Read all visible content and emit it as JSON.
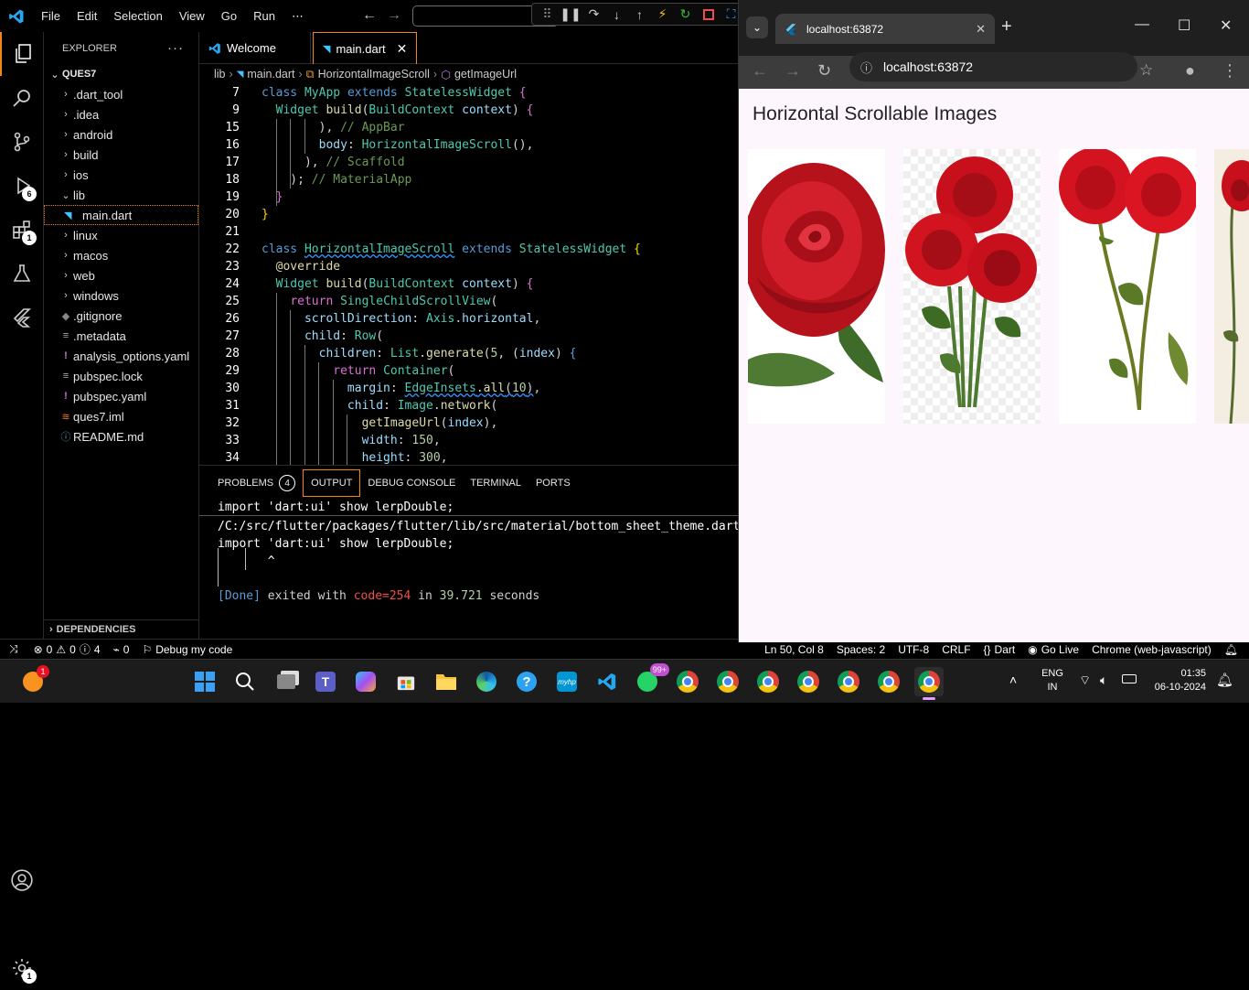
{
  "titlebar": {
    "menus": [
      "File",
      "Edit",
      "Selection",
      "View",
      "Go",
      "Run",
      "⋯"
    ]
  },
  "activity": {
    "run_badge": "6",
    "extensions_badge": "1",
    "settings_badge": "1"
  },
  "explorer": {
    "title": "EXPLORER",
    "folder": "QUES7",
    "items": [
      {
        "label": ".dart_tool",
        "type": "folder"
      },
      {
        "label": ".idea",
        "type": "folder"
      },
      {
        "label": "android",
        "type": "folder"
      },
      {
        "label": "build",
        "type": "folder"
      },
      {
        "label": "ios",
        "type": "folder"
      },
      {
        "label": "lib",
        "type": "folder-open"
      },
      {
        "label": "main.dart",
        "type": "file-dart"
      },
      {
        "label": "linux",
        "type": "folder"
      },
      {
        "label": "macos",
        "type": "folder"
      },
      {
        "label": "web",
        "type": "folder"
      },
      {
        "label": "windows",
        "type": "folder"
      },
      {
        "label": ".gitignore",
        "type": "file"
      },
      {
        "label": ".metadata",
        "type": "file"
      },
      {
        "label": "analysis_options.yaml",
        "type": "file-yaml"
      },
      {
        "label": "pubspec.lock",
        "type": "file"
      },
      {
        "label": "pubspec.yaml",
        "type": "file-yaml"
      },
      {
        "label": "ques7.iml",
        "type": "file"
      },
      {
        "label": "README.md",
        "type": "file-info"
      }
    ],
    "dependencies": "DEPENDENCIES"
  },
  "tabs": [
    {
      "label": "Welcome",
      "active": false
    },
    {
      "label": "main.dart",
      "active": true
    }
  ],
  "breadcrumb": [
    "lib",
    "main.dart",
    "HorizontalImageScroll",
    "getImageUrl"
  ],
  "code_lines": [
    "7",
    "9",
    "15",
    "16",
    "17",
    "18",
    "19",
    "20",
    "21",
    "22",
    "23",
    "24",
    "25",
    "26",
    "27",
    "28",
    "29",
    "30",
    "31",
    "32",
    "33",
    "34"
  ],
  "panel": {
    "tabs": [
      "PROBLEMS",
      "OUTPUT",
      "DEBUG CONSOLE",
      "TERMINAL",
      "PORTS"
    ],
    "problems_count": "4",
    "output_lines": [
      "import 'dart:ui' show lerpDouble;",
      "/C:/src/flutter/packages/flutter/lib/src/material/bottom_sheet_theme.dart:",
      "import 'dart:ui' show lerpDouble;",
      "       ^"
    ],
    "done_line": {
      "prefix": "[Done]",
      "middle": " exited with ",
      "code": "code=254",
      "suffix": " in ",
      "time": "39.721",
      "end": " seconds"
    }
  },
  "statusbar": {
    "errors": "0",
    "warnings": "0",
    "infos": "4",
    "ports": "0",
    "debug": "Debug my code",
    "position": "Ln 50, Col 8",
    "spaces": "Spaces: 2",
    "encoding": "UTF-8",
    "eol": "CRLF",
    "language": "Dart",
    "golive": "Go Live",
    "device": "Chrome (web-javascript)"
  },
  "browser": {
    "tab_title": "localhost:63872",
    "url": "localhost:63872",
    "page_title": "Horizontal Scrollable Images"
  },
  "taskbar": {
    "whatsapp_badge": "99+",
    "lang_line1": "ENG",
    "lang_line2": "IN",
    "time": "01:35",
    "date": "06-10-2024"
  },
  "colors": {
    "accent_orange": "#f38518",
    "vscode_blue": "#23a9f2",
    "rose_red": "#c1121f"
  }
}
